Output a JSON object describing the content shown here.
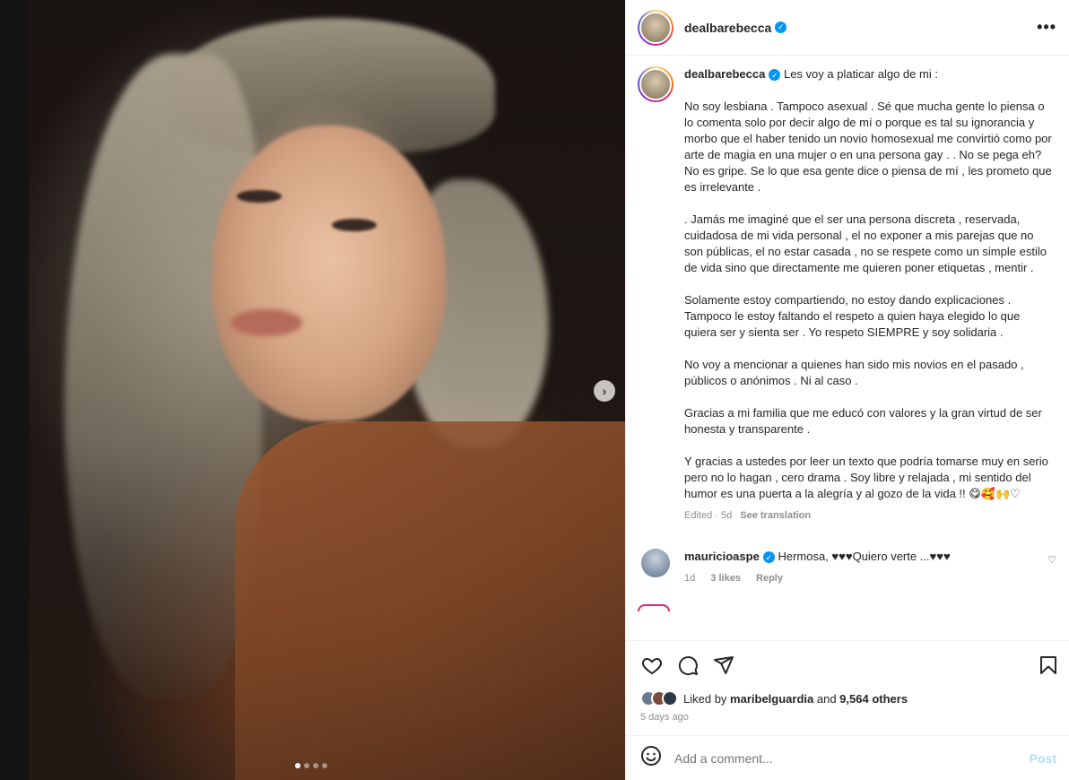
{
  "post": {
    "username": "dealbarebecca",
    "caption_intro": "Les voy a platicar algo de mi :",
    "caption_paragraphs": [
      "No soy lesbiana . Tampoco asexual . Sé que mucha gente lo piensa o lo comenta solo por decir algo de mí o porque es tal su ignorancia y morbo que el haber tenido un novio homosexual me convirtió como por arte de magia en una mujer o en una persona gay . . No se pega eh? No es gripe. Se lo que esa gente dice o piensa de mí , les prometo que es irrelevante .",
      ". Jamás me imaginé que el ser una persona discreta , reservada, cuidadosa de mi vida personal , el no exponer a mis parejas que no son públicas, el no estar casada , no se respete como un simple estilo de vida sino que directamente me quieren poner etiquetas , mentir .",
      "Solamente estoy compartiendo, no estoy dando explicaciones . Tampoco le estoy faltando el respeto a quien haya elegido lo que quiera ser y sienta ser . Yo respeto SIEMPRE y soy solidaria .",
      "No voy a mencionar a quienes han sido mis novios en el pasado , públicos o anónimos . Ni al caso .",
      "Gracias a mi familia que me educó con valores y la gran virtud de ser honesta y transparente .",
      "Y gracias a ustedes por leer un texto que podría tomarse muy en serio pero no lo hagan , cero drama . Soy libre y relajada , mi sentido del humor es una puerta a la alegría y al gozo de la vida !! 😋🥰🙌♡"
    ],
    "edited_label": "Edited · 5d",
    "see_translation": "See translation",
    "more_icon": "•••"
  },
  "comment": {
    "username": "mauricioaspe",
    "text": "Hermosa, ♥♥♥Quiero verte ...♥♥♥",
    "age": "1d",
    "likes": "3 likes",
    "reply": "Reply"
  },
  "likes": {
    "prefix": "Liked by ",
    "user": "maribelguardia",
    "middle": " and ",
    "count": "9,564 others"
  },
  "date": "5 days ago",
  "add_comment": {
    "placeholder": "Add a comment...",
    "post_label": "Post"
  },
  "carousel": {
    "next_glyph": "›",
    "slides": 4,
    "active_index": 0
  },
  "colors": {
    "verified": "#0095f6",
    "post_disabled": "#b2dffc",
    "meta_gray": "#8e8e8e"
  }
}
